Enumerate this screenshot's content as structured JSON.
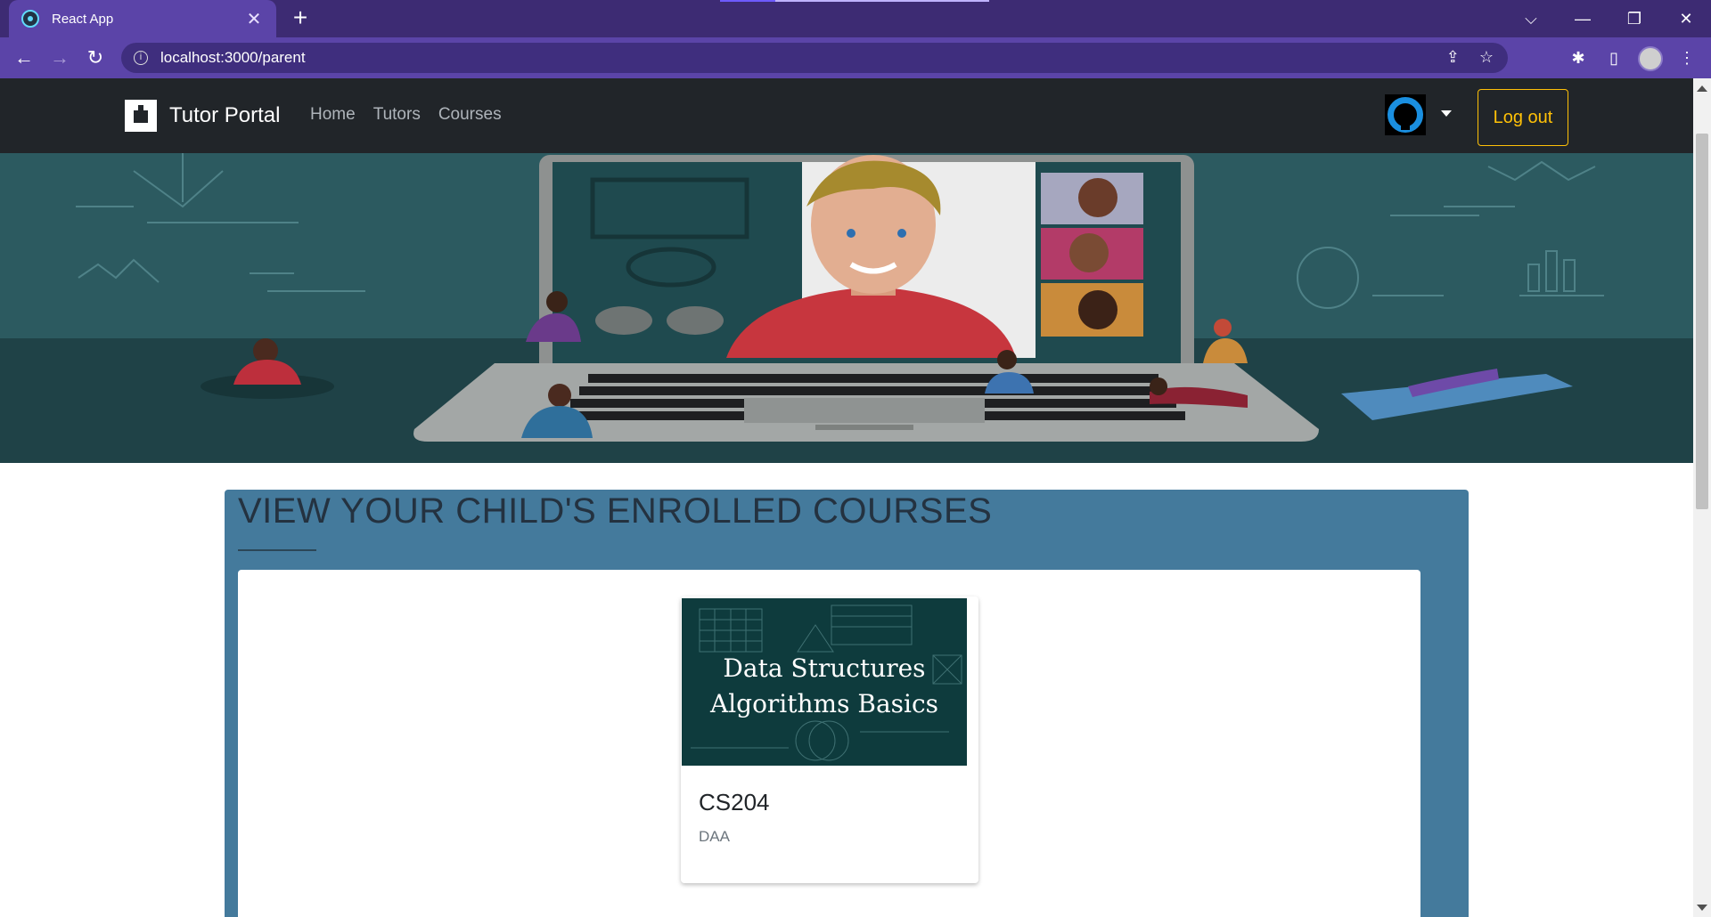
{
  "browser": {
    "tab_title": "React App",
    "tab_close": "✕",
    "new_tab": "+",
    "url": "localhost:3000/parent",
    "window_controls": {
      "dropdown": "⌵",
      "minimize": "—",
      "restore": "❐",
      "close": "✕"
    },
    "nav": {
      "back": "←",
      "forward": "→",
      "reload": "↻"
    },
    "icons": {
      "share": "⇪",
      "star": "☆",
      "extensions": "✱",
      "sidepanel": "▯",
      "menu": "⋮",
      "info": "i"
    }
  },
  "navbar": {
    "brand": "Tutor Portal",
    "links": [
      "Home",
      "Tutors",
      "Courses"
    ],
    "logout_label": "Log out"
  },
  "section": {
    "heading": "VIEW YOUR CHILD'S ENROLLED COURSES"
  },
  "courses": [
    {
      "image_text_line1": "Data Structures",
      "image_text_line2": "Algorithms Basics",
      "code": "CS204",
      "name": "DAA"
    }
  ],
  "colors": {
    "browser_frame": "#3d2b73",
    "browser_toolbar": "#5b44a8",
    "navbar": "#212529",
    "logout_accent": "#ffc107",
    "hero": "#244d52",
    "section_bg": "#447a9c"
  }
}
